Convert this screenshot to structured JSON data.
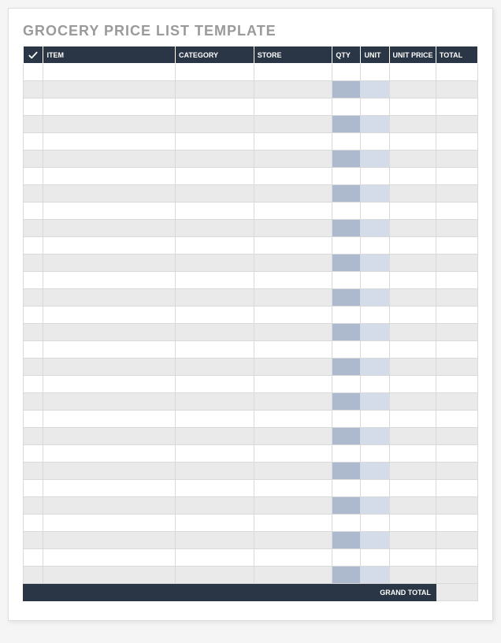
{
  "title": "GROCERY PRICE LIST TEMPLATE",
  "columns": {
    "check": "",
    "item": "ITEM",
    "category": "CATEGORY",
    "store": "STORE",
    "qty": "QTY",
    "unit": "UNIT",
    "unit_price": "UNIT PRICE",
    "total": "TOTAL"
  },
  "rows": [
    {
      "check": "",
      "item": "",
      "category": "",
      "store": "",
      "qty": "",
      "unit": "",
      "unit_price": "",
      "total": ""
    },
    {
      "check": "",
      "item": "",
      "category": "",
      "store": "",
      "qty": "",
      "unit": "",
      "unit_price": "",
      "total": ""
    },
    {
      "check": "",
      "item": "",
      "category": "",
      "store": "",
      "qty": "",
      "unit": "",
      "unit_price": "",
      "total": ""
    },
    {
      "check": "",
      "item": "",
      "category": "",
      "store": "",
      "qty": "",
      "unit": "",
      "unit_price": "",
      "total": ""
    },
    {
      "check": "",
      "item": "",
      "category": "",
      "store": "",
      "qty": "",
      "unit": "",
      "unit_price": "",
      "total": ""
    },
    {
      "check": "",
      "item": "",
      "category": "",
      "store": "",
      "qty": "",
      "unit": "",
      "unit_price": "",
      "total": ""
    },
    {
      "check": "",
      "item": "",
      "category": "",
      "store": "",
      "qty": "",
      "unit": "",
      "unit_price": "",
      "total": ""
    },
    {
      "check": "",
      "item": "",
      "category": "",
      "store": "",
      "qty": "",
      "unit": "",
      "unit_price": "",
      "total": ""
    },
    {
      "check": "",
      "item": "",
      "category": "",
      "store": "",
      "qty": "",
      "unit": "",
      "unit_price": "",
      "total": ""
    },
    {
      "check": "",
      "item": "",
      "category": "",
      "store": "",
      "qty": "",
      "unit": "",
      "unit_price": "",
      "total": ""
    },
    {
      "check": "",
      "item": "",
      "category": "",
      "store": "",
      "qty": "",
      "unit": "",
      "unit_price": "",
      "total": ""
    },
    {
      "check": "",
      "item": "",
      "category": "",
      "store": "",
      "qty": "",
      "unit": "",
      "unit_price": "",
      "total": ""
    },
    {
      "check": "",
      "item": "",
      "category": "",
      "store": "",
      "qty": "",
      "unit": "",
      "unit_price": "",
      "total": ""
    },
    {
      "check": "",
      "item": "",
      "category": "",
      "store": "",
      "qty": "",
      "unit": "",
      "unit_price": "",
      "total": ""
    },
    {
      "check": "",
      "item": "",
      "category": "",
      "store": "",
      "qty": "",
      "unit": "",
      "unit_price": "",
      "total": ""
    },
    {
      "check": "",
      "item": "",
      "category": "",
      "store": "",
      "qty": "",
      "unit": "",
      "unit_price": "",
      "total": ""
    },
    {
      "check": "",
      "item": "",
      "category": "",
      "store": "",
      "qty": "",
      "unit": "",
      "unit_price": "",
      "total": ""
    },
    {
      "check": "",
      "item": "",
      "category": "",
      "store": "",
      "qty": "",
      "unit": "",
      "unit_price": "",
      "total": ""
    },
    {
      "check": "",
      "item": "",
      "category": "",
      "store": "",
      "qty": "",
      "unit": "",
      "unit_price": "",
      "total": ""
    },
    {
      "check": "",
      "item": "",
      "category": "",
      "store": "",
      "qty": "",
      "unit": "",
      "unit_price": "",
      "total": ""
    },
    {
      "check": "",
      "item": "",
      "category": "",
      "store": "",
      "qty": "",
      "unit": "",
      "unit_price": "",
      "total": ""
    },
    {
      "check": "",
      "item": "",
      "category": "",
      "store": "",
      "qty": "",
      "unit": "",
      "unit_price": "",
      "total": ""
    },
    {
      "check": "",
      "item": "",
      "category": "",
      "store": "",
      "qty": "",
      "unit": "",
      "unit_price": "",
      "total": ""
    },
    {
      "check": "",
      "item": "",
      "category": "",
      "store": "",
      "qty": "",
      "unit": "",
      "unit_price": "",
      "total": ""
    },
    {
      "check": "",
      "item": "",
      "category": "",
      "store": "",
      "qty": "",
      "unit": "",
      "unit_price": "",
      "total": ""
    },
    {
      "check": "",
      "item": "",
      "category": "",
      "store": "",
      "qty": "",
      "unit": "",
      "unit_price": "",
      "total": ""
    },
    {
      "check": "",
      "item": "",
      "category": "",
      "store": "",
      "qty": "",
      "unit": "",
      "unit_price": "",
      "total": ""
    },
    {
      "check": "",
      "item": "",
      "category": "",
      "store": "",
      "qty": "",
      "unit": "",
      "unit_price": "",
      "total": ""
    },
    {
      "check": "",
      "item": "",
      "category": "",
      "store": "",
      "qty": "",
      "unit": "",
      "unit_price": "",
      "total": ""
    },
    {
      "check": "",
      "item": "",
      "category": "",
      "store": "",
      "qty": "",
      "unit": "",
      "unit_price": "",
      "total": ""
    }
  ],
  "footer": {
    "grand_total_label": "GRAND TOTAL",
    "grand_total_value": ""
  }
}
